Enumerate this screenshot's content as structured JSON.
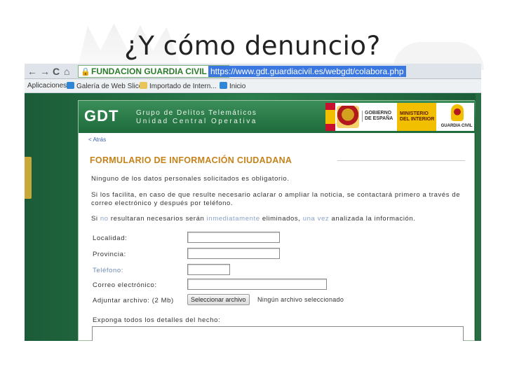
{
  "slide": {
    "title": "¿Y cómo denuncio?"
  },
  "browser": {
    "back_icon": "←",
    "forward_icon": "→",
    "reload_icon": "C",
    "home_icon": "⌂",
    "ssl_label": "FUNDACION GUARDIA CIVIL [ES]",
    "url": "https://www.gdt.guardiacivil.es/webgdt/colabora.php",
    "bookmarks": [
      {
        "label": "Aplicaciones",
        "icon": "apps-icon",
        "color": "#4a7bd0"
      },
      {
        "label": "Galería de Web Slice",
        "icon": "ie-icon",
        "color": "#2f86d6"
      },
      {
        "label": "Importado de Intern...",
        "icon": "folder-icon",
        "color": "#e8c55a"
      },
      {
        "label": "Inicio",
        "icon": "ie-icon",
        "color": "#2f86d6"
      }
    ]
  },
  "site": {
    "logo": "GDT",
    "tagline_1": "Grupo de Delitos Telemáticos",
    "tagline_2": "Unidad Central Operativa",
    "gov_label_1": "GOBIERNO",
    "gov_label_2": "DE ESPAÑA",
    "ministry_label_1": "MINISTERIO",
    "ministry_label_2": "DEL INTERIOR",
    "guardia_label": "GUARDIA CIVIL",
    "back_link": "< Atrás"
  },
  "form": {
    "title": "FORMULARIO DE INFORMACIÓN CIUDADANA",
    "para_1": "Ninguno de los datos personales solicitados es obligatorio.",
    "para_2": "Si los facilita, en caso de que resulte necesario aclarar o ampliar la noticia, se contactará primero a través de correo electrónico y después por teléfono.",
    "para_3_a": "Si ",
    "para_3_b": "no",
    "para_3_c": " resultaran necesarios serán ",
    "para_3_d": "inmediatamente",
    "para_3_e": " eliminados, ",
    "para_3_f": "una vez",
    "para_3_g": " analizada la información.",
    "fields": {
      "locality": "Localidad:",
      "province": "Provincia:",
      "phone": "Teléfono:",
      "email": "Correo electrónico:",
      "attach": "Adjuntar archivo: (2 Mb)"
    },
    "file_button": "Seleccionar archivo",
    "file_status": "Ningún archivo seleccionado",
    "details_label": "Exponga todos los detalles del hecho:"
  },
  "colors": {
    "site_green": "#1f6a42",
    "title_orange": "#c6821a",
    "url_highlight": "#3a77e0"
  }
}
